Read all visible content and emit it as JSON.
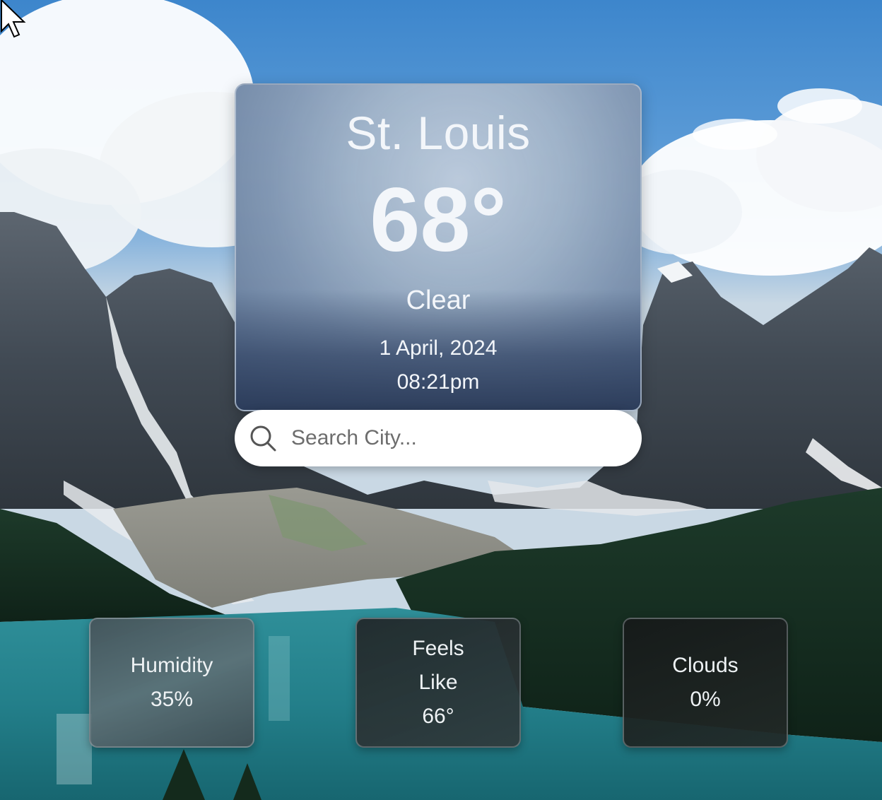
{
  "weather": {
    "city": "St. Louis",
    "temperature": "68°",
    "condition": "Clear",
    "date": "1 April, 2024",
    "time": "08:21pm"
  },
  "search": {
    "placeholder": "Search City..."
  },
  "stats": {
    "humidity": {
      "label": "Humidity",
      "value": "35%"
    },
    "feels_like": {
      "label": "Feels Like",
      "value": "66°"
    },
    "clouds": {
      "label": "Clouds",
      "value": "0%"
    }
  },
  "icons": {
    "search": "search-icon",
    "cursor": "mouse-pointer-icon"
  },
  "colors": {
    "sky": "#3d86cc",
    "card_text": "#f3f6fa",
    "search_bg": "#ffffff"
  }
}
